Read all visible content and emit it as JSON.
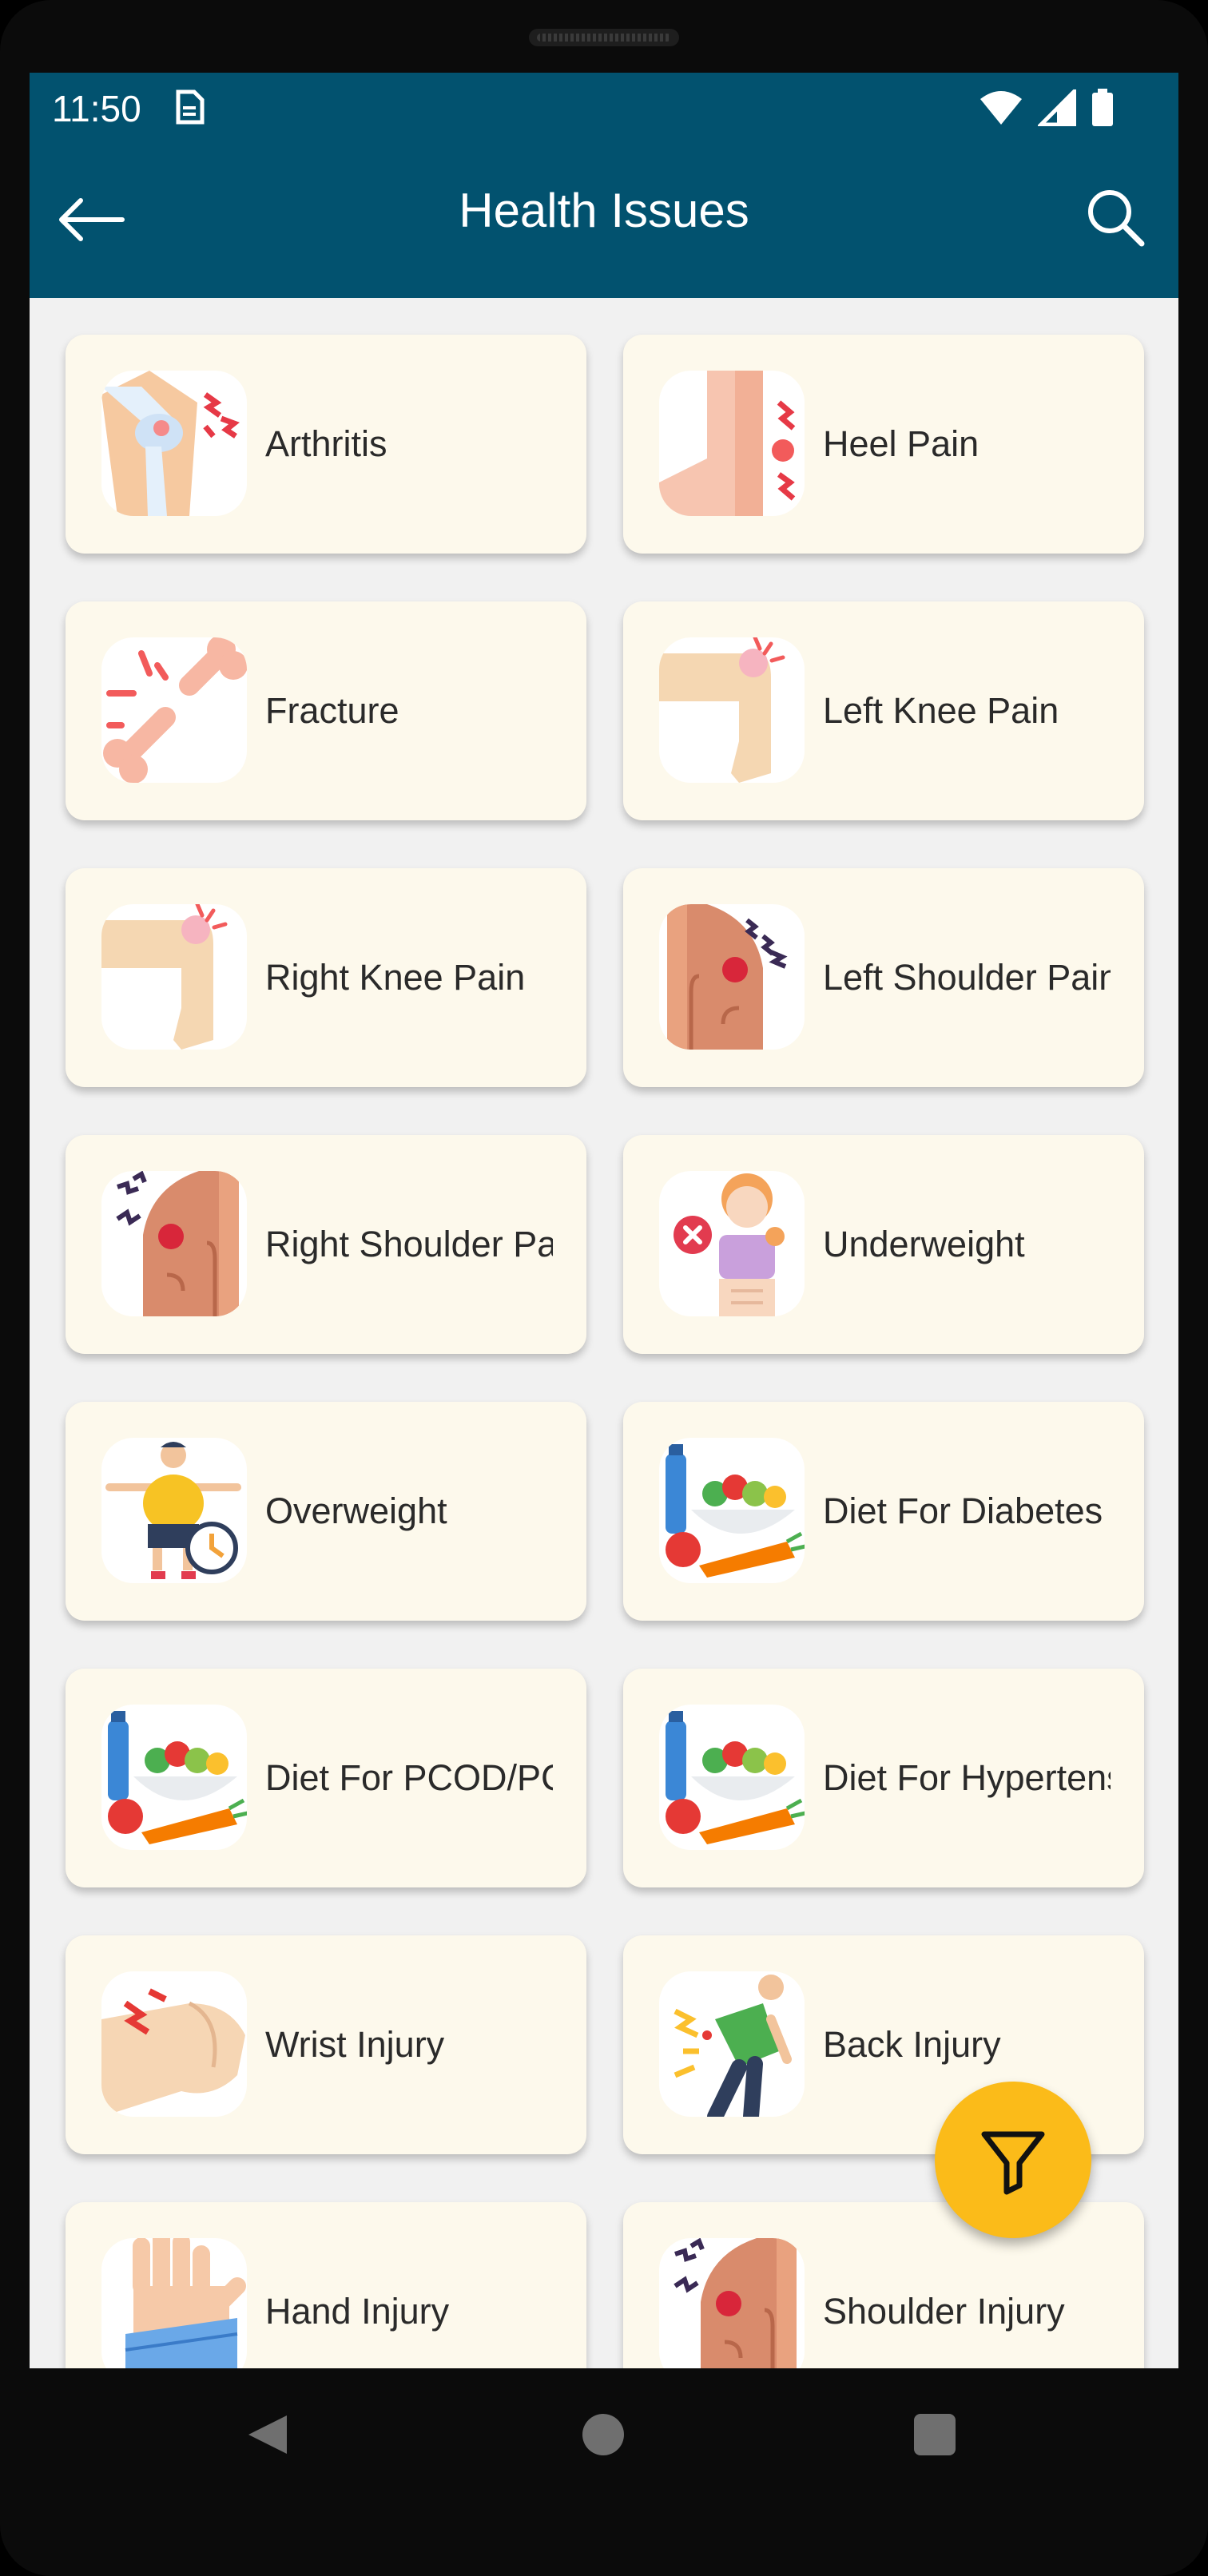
{
  "status_bar": {
    "time": "11:50",
    "icons": [
      "sim-card-icon",
      "wifi-icon",
      "signal-icon",
      "battery-icon"
    ]
  },
  "app_bar": {
    "title": "Health Issues",
    "back_icon": "arrow-left-icon",
    "search_icon": "search-icon"
  },
  "colors": {
    "app_bar": "#02526f",
    "card_bg": "#fdf9ec",
    "fab": "#fbbb19",
    "screen_bg": "#f1f1f1"
  },
  "issues": [
    {
      "label": "Arthritis",
      "icon": "knee-joint-icon"
    },
    {
      "label": "Heel Pain",
      "icon": "heel-pain-icon"
    },
    {
      "label": "Fracture",
      "icon": "broken-bone-icon"
    },
    {
      "label": "Left Knee Pain",
      "icon": "left-knee-icon"
    },
    {
      "label": "Right Knee Pain",
      "icon": "right-knee-icon"
    },
    {
      "label": "Left Shoulder Pain",
      "icon": "left-shoulder-icon"
    },
    {
      "label": "Right Shoulder Pain",
      "icon": "right-shoulder-icon"
    },
    {
      "label": "Underweight",
      "icon": "underweight-person-icon"
    },
    {
      "label": "Overweight",
      "icon": "overweight-person-icon"
    },
    {
      "label": "Diet For Diabetes",
      "icon": "healthy-food-icon"
    },
    {
      "label": "Diet For PCOD/PCOS",
      "icon": "healthy-food-icon"
    },
    {
      "label": "Diet For Hypertension",
      "icon": "healthy-food-icon"
    },
    {
      "label": "Wrist Injury",
      "icon": "wrist-injury-icon"
    },
    {
      "label": "Back Injury",
      "icon": "back-injury-icon"
    },
    {
      "label": "Hand Injury",
      "icon": "hand-injury-icon"
    },
    {
      "label": "Shoulder Injury",
      "icon": "shoulder-injury-icon"
    }
  ],
  "fab": {
    "icon": "filter-icon"
  },
  "nav": {
    "back_icon": "nav-back-icon",
    "home_icon": "nav-home-icon",
    "recent_icon": "nav-recents-icon"
  }
}
